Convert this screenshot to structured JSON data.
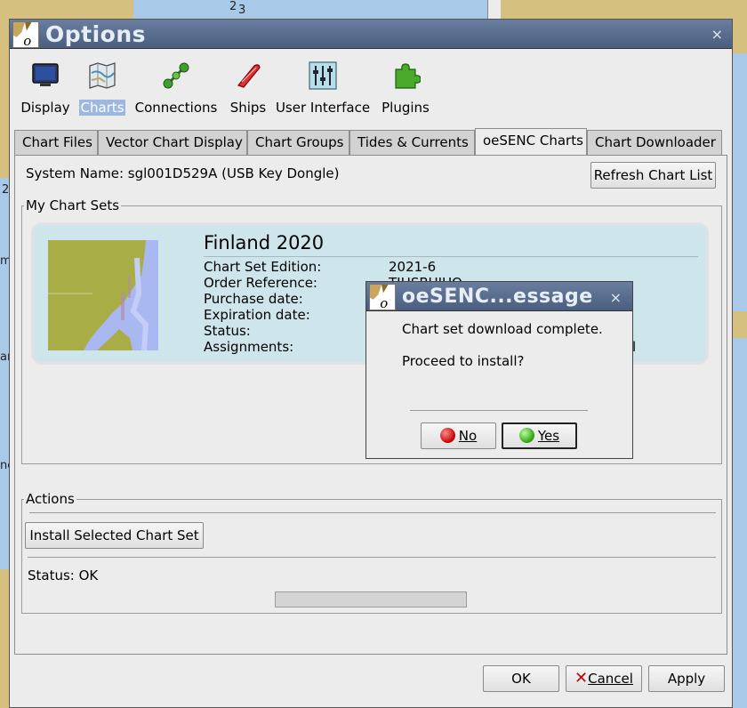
{
  "background": {
    "map_labels": [
      "2",
      "3",
      "2",
      "m",
      "are",
      "ne"
    ]
  },
  "window": {
    "title": "Options",
    "close_glyph": "×"
  },
  "toolbar": {
    "items": [
      {
        "label": "Display",
        "icon": "monitor-icon"
      },
      {
        "label": "Charts",
        "icon": "chart-map-icon",
        "selected": true
      },
      {
        "label": "Connections",
        "icon": "connections-icon"
      },
      {
        "label": "Ships",
        "icon": "ship-icon"
      },
      {
        "label": "User Interface",
        "icon": "sliders-icon"
      },
      {
        "label": "Plugins",
        "icon": "puzzle-icon"
      }
    ]
  },
  "tabs": [
    {
      "label": "Chart Files"
    },
    {
      "label": "Vector Chart Display"
    },
    {
      "label": "Chart Groups"
    },
    {
      "label": "Tides & Currents"
    },
    {
      "label": "oeSENC Charts",
      "active": true
    },
    {
      "label": "Chart Downloader"
    }
  ],
  "panel": {
    "system_name": "System Name: sgl001D529A (USB Key Dongle)",
    "refresh_button": "Refresh Chart List",
    "chart_sets_label": "My Chart Sets",
    "chart_set": {
      "name": "Finland 2020",
      "fields": [
        {
          "label": "Chart Set Edition:",
          "value": "2021-6"
        },
        {
          "label": "Order Reference:",
          "value": "TIHSBUIUQ"
        },
        {
          "label": "Purchase date:",
          "value": ""
        },
        {
          "label": "Expiration date:",
          "value": ""
        },
        {
          "label": "Status:",
          "value": ""
        },
        {
          "label": "Assignments:",
          "value": "l"
        }
      ]
    },
    "actions_label": "Actions",
    "install_button": "Install Selected Chart Set",
    "status": "Status: OK"
  },
  "footer": {
    "ok": "OK",
    "cancel": "Cancel",
    "apply": "Apply"
  },
  "dialog": {
    "title": "oeSENC...essage",
    "close_glyph": "×",
    "message": "Chart set download complete.",
    "question": "Proceed to install?",
    "no_label": "No",
    "yes_label": "Yes"
  },
  "colors": {
    "titlebar": "#4a5f80",
    "selected_toolbar": "#9db7df",
    "chart_card": "#cfe5ec",
    "no_button_dot": "#c00000",
    "yes_button_dot": "#2e9e12"
  }
}
